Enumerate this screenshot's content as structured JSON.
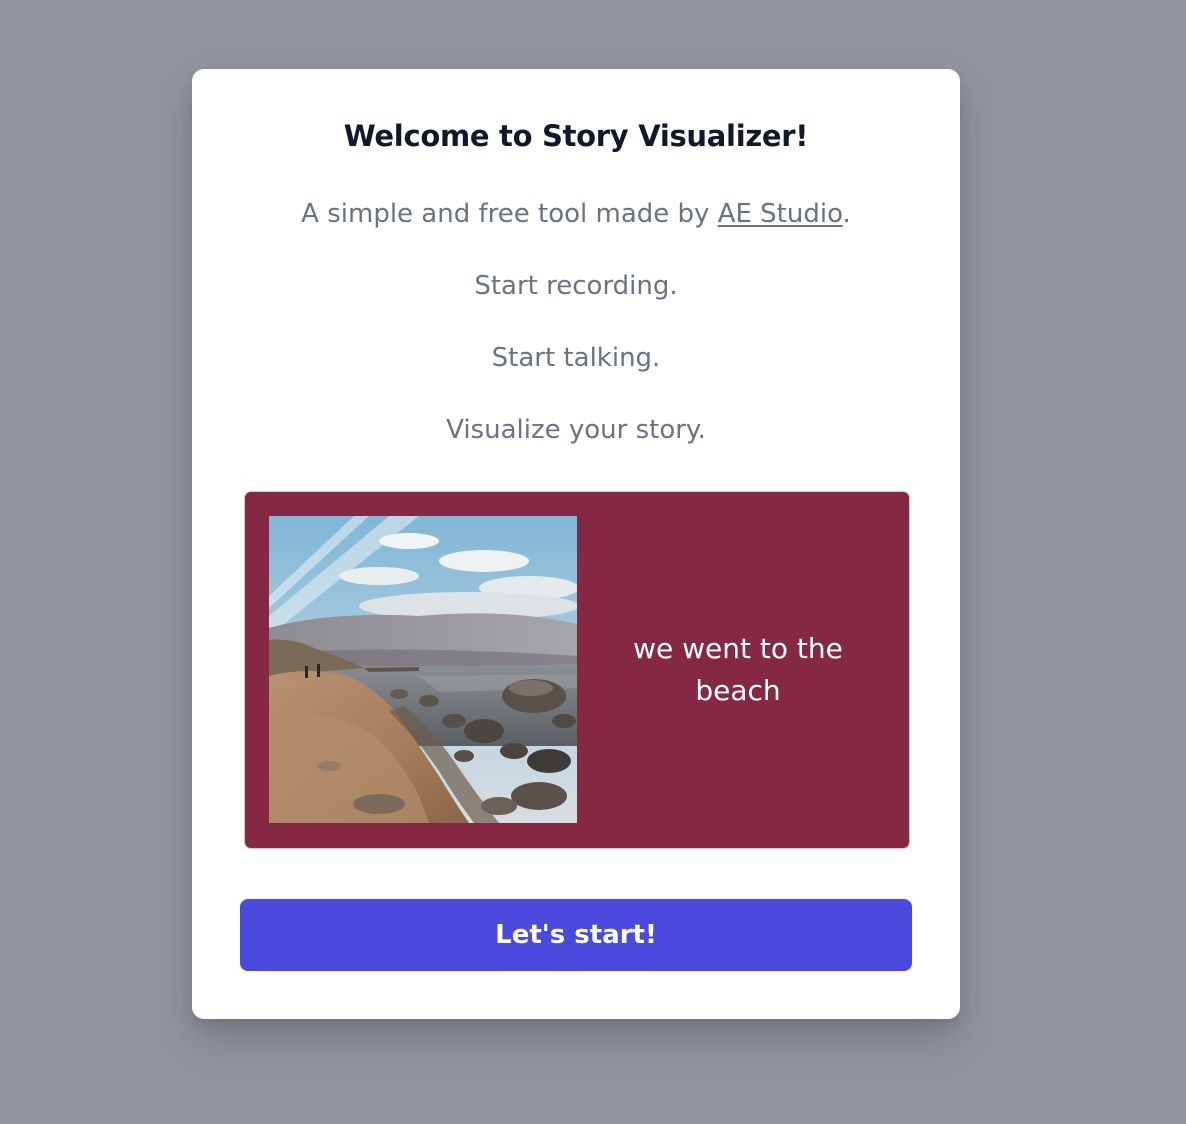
{
  "dialog": {
    "title": "Welcome to Story Visualizer!",
    "intro_prefix": "A simple and free tool made by ",
    "intro_link": "AE Studio",
    "intro_suffix": ".",
    "steps": [
      "Start recording.",
      "Start talking.",
      "Visualize your story."
    ]
  },
  "preview": {
    "caption": "we went to the beach",
    "background_color": "#852843"
  },
  "actions": {
    "start_label": "Let's start!"
  },
  "colors": {
    "page_overlay": "#9095a0",
    "primary_button": "#4a4ade",
    "title_text": "#111827",
    "body_text": "#6b7280"
  }
}
